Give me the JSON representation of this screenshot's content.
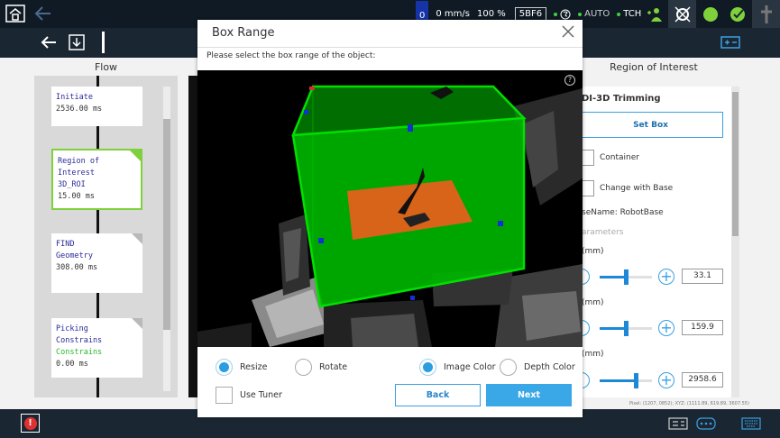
{
  "topbar": {
    "status_zero": "0",
    "speed": "0 mm/s",
    "override": "100 %",
    "code": "5BF6",
    "mode_auto": "AUTO",
    "mode_tch": "TCH",
    "accent_green": "#7fd13b"
  },
  "flow": {
    "title": "Flow",
    "cards": [
      {
        "line1": "Initiate",
        "line2": "",
        "line3": "2536.00 ms"
      },
      {
        "line1": "Region of Interest",
        "line2": "3D_ROI",
        "line3": "15.00 ms"
      },
      {
        "line1": "FIND",
        "line2": "Geometry",
        "line3": "308.00 ms"
      },
      {
        "line1": "Picking Constrains",
        "line2": "Constrains",
        "line3": "0.00 ms"
      }
    ]
  },
  "roi": {
    "title": "Region of Interest",
    "header": "DI-3D Trimming",
    "set_box": "Set Box",
    "container_label": "Container",
    "change_base_label": "Change with Base",
    "basename": "seName: RobotBase",
    "parameters_label": "arameters",
    "sliders": [
      {
        "unit": "(mm)",
        "value": "33.1",
        "level": 0.5
      },
      {
        "unit": "(mm)",
        "value": "159.9",
        "level": 0.5
      },
      {
        "unit": "(mm)",
        "value": "2958.6",
        "level": 0.72
      }
    ],
    "pixel_readout": "Pixel: (1207, 0852); XYZ: (1111.89, 619.89, 3607.55)"
  },
  "modal": {
    "title": "Box Range",
    "subtitle": "Please select the box range of the object:",
    "help": "?",
    "options": {
      "resize": "Resize",
      "rotate": "Rotate",
      "image_color": "Image Color",
      "depth_color": "Depth Color",
      "use_tuner": "Use Tuner"
    },
    "back": "Back",
    "next": "Next",
    "box_color": "#00c800",
    "plate_color": "#d8641a"
  },
  "bottombar": {
    "alert": "!"
  }
}
